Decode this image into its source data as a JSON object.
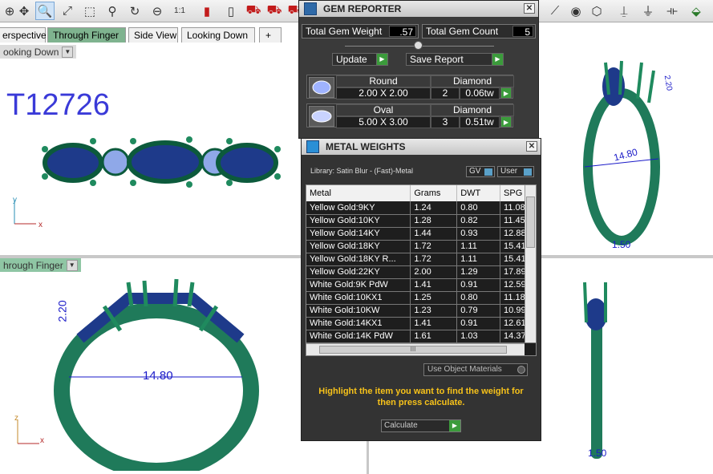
{
  "toolbar": {
    "icons": [
      "move-icon",
      "zoom-in-icon",
      "zoom-extents-icon",
      "zoom-window-icon",
      "pan-icon",
      "rotate-icon",
      "zoom-out-icon",
      "zoom-1to1-icon",
      "red-car-icon",
      "phone-icon",
      "small-car-icon",
      "car-icon",
      "truck-icon",
      "render-icon"
    ],
    "zoom_1to1_label": "1:1"
  },
  "tabs": {
    "items": [
      {
        "label": "erspective"
      },
      {
        "label": "Through Finger"
      },
      {
        "label": "Side View"
      },
      {
        "label": "Looking Down"
      }
    ],
    "add_label": "+"
  },
  "viewports": {
    "top_left_label": "ooking Down",
    "bottom_left_label": "hrough Finger",
    "part_code": "T12726",
    "dims": {
      "height_left": "2.20",
      "width_left": "14.80",
      "height_right": "2.20",
      "width_right": "14.80",
      "thick_right": "1.50",
      "thick_bottom_right": "1.50"
    },
    "axis_top_left": {
      "y": "y",
      "x": "x"
    },
    "axis_bottom_left": {
      "z": "z",
      "x": "x"
    }
  },
  "gem_reporter": {
    "title": "GEM REPORTER",
    "total_weight_label": "Total Gem Weight",
    "total_weight_value": ".57",
    "total_count_label": "Total Gem Count",
    "total_count_value": "5",
    "update_label": "Update",
    "save_report_label": "Save Report",
    "gems": [
      {
        "shape": "Round",
        "size": "2.00 X 2.00",
        "type": "Diamond",
        "count": "2",
        "weight": "0.06tw"
      },
      {
        "shape": "Oval",
        "size": "5.00 X 3.00",
        "type": "Diamond",
        "count": "3",
        "weight": "0.51tw"
      }
    ]
  },
  "metal_weights": {
    "title": "METAL WEIGHTS",
    "library": "Library: Satin Blur - (Fast)-Metal",
    "gv_label": "GV",
    "user_label": "User",
    "columns": [
      "Metal",
      "Grams",
      "DWT",
      "SPG"
    ],
    "rows": [
      [
        "Yellow Gold:9KY",
        "1.24",
        "0.80",
        "11.08"
      ],
      [
        "Yellow Gold:10KY",
        "1.28",
        "0.82",
        "11.45"
      ],
      [
        "Yellow Gold:14KY",
        "1.44",
        "0.93",
        "12.88"
      ],
      [
        "Yellow Gold:18KY",
        "1.72",
        "1.11",
        "15.41"
      ],
      [
        "Yellow Gold:18KY R...",
        "1.72",
        "1.11",
        "15.41"
      ],
      [
        "Yellow Gold:22KY",
        "2.00",
        "1.29",
        "17.89"
      ],
      [
        "White Gold:9K PdW",
        "1.41",
        "0.91",
        "12.59"
      ],
      [
        "White Gold:10KX1",
        "1.25",
        "0.80",
        "11.18"
      ],
      [
        "White Gold:10KW",
        "1.23",
        "0.79",
        "10.99"
      ],
      [
        "White Gold:14KX1",
        "1.41",
        "0.91",
        "12.61"
      ],
      [
        "White Gold:14K PdW",
        "1.61",
        "1.03",
        "14.37"
      ]
    ],
    "scroll_grip": "III",
    "use_object_materials": "Use Object Materials",
    "hint": "Highlight the item you want to find the weight for then press calculate.",
    "calculate_label": "Calculate"
  }
}
